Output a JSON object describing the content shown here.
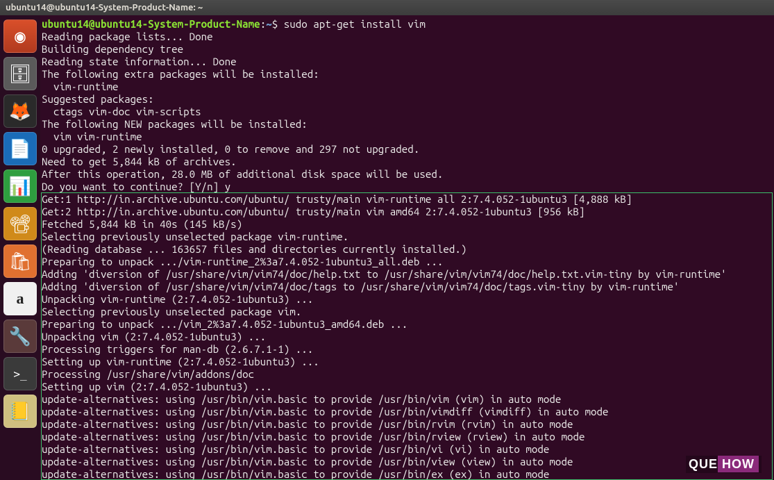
{
  "window": {
    "title": "ubuntu14@ubuntu14-System-Product-Name: ~"
  },
  "launcher": {
    "items": [
      {
        "name": "dash-icon",
        "glyph": "◉"
      },
      {
        "name": "files-icon",
        "glyph": "🗄"
      },
      {
        "name": "firefox-icon",
        "glyph": "🦊"
      },
      {
        "name": "writer-icon",
        "glyph": "📄"
      },
      {
        "name": "calc-icon",
        "glyph": "📊"
      },
      {
        "name": "impress-icon",
        "glyph": "📽"
      },
      {
        "name": "software-center-icon",
        "glyph": "🛍"
      },
      {
        "name": "amazon-icon",
        "glyph": "a"
      },
      {
        "name": "settings-icon",
        "glyph": "🔧"
      },
      {
        "name": "terminal-icon",
        "glyph": ">_"
      },
      {
        "name": "help-icon",
        "glyph": "📒"
      }
    ]
  },
  "prompt": {
    "userhost": "ubuntu14@ubuntu14-System-Product-Name",
    "path": "~",
    "command": "sudo apt-get install vim"
  },
  "output_top": [
    "Reading package lists... Done",
    "Building dependency tree",
    "Reading state information... Done",
    "The following extra packages will be installed:",
    "  vim-runtime",
    "Suggested packages:",
    "  ctags vim-doc vim-scripts",
    "The following NEW packages will be installed:",
    "  vim vim-runtime",
    "0 upgraded, 2 newly installed, 0 to remove and 297 not upgraded.",
    "Need to get 5,844 kB of archives.",
    "After this operation, 28.0 MB of additional disk space will be used.",
    "Do you want to continue? [Y/n] y"
  ],
  "output_box": [
    "Get:1 http://in.archive.ubuntu.com/ubuntu/ trusty/main vim-runtime all 2:7.4.052-1ubuntu3 [4,888 kB]",
    "Get:2 http://in.archive.ubuntu.com/ubuntu/ trusty/main vim amd64 2:7.4.052-1ubuntu3 [956 kB]",
    "Fetched 5,844 kB in 40s (145 kB/s)",
    "Selecting previously unselected package vim-runtime.",
    "(Reading database ... 163657 files and directories currently installed.)",
    "Preparing to unpack .../vim-runtime_2%3a7.4.052-1ubuntu3_all.deb ...",
    "Adding 'diversion of /usr/share/vim/vim74/doc/help.txt to /usr/share/vim/vim74/doc/help.txt.vim-tiny by vim-runtime'",
    "Adding 'diversion of /usr/share/vim/vim74/doc/tags to /usr/share/vim/vim74/doc/tags.vim-tiny by vim-runtime'",
    "Unpacking vim-runtime (2:7.4.052-1ubuntu3) ...",
    "Selecting previously unselected package vim.",
    "Preparing to unpack .../vim_2%3a7.4.052-1ubuntu3_amd64.deb ...",
    "Unpacking vim (2:7.4.052-1ubuntu3) ...",
    "Processing triggers for man-db (2.6.7.1-1) ...",
    "Setting up vim-runtime (2:7.4.052-1ubuntu3) ...",
    "Processing /usr/share/vim/addons/doc",
    "Setting up vim (2:7.4.052-1ubuntu3) ...",
    "update-alternatives: using /usr/bin/vim.basic to provide /usr/bin/vim (vim) in auto mode",
    "update-alternatives: using /usr/bin/vim.basic to provide /usr/bin/vimdiff (vimdiff) in auto mode",
    "update-alternatives: using /usr/bin/vim.basic to provide /usr/bin/rvim (rvim) in auto mode",
    "update-alternatives: using /usr/bin/vim.basic to provide /usr/bin/rview (rview) in auto mode",
    "update-alternatives: using /usr/bin/vim.basic to provide /usr/bin/vi (vi) in auto mode",
    "update-alternatives: using /usr/bin/vim.basic to provide /usr/bin/view (view) in auto mode",
    "update-alternatives: using /usr/bin/vim.basic to provide /usr/bin/ex (ex) in auto mode"
  ],
  "watermark": {
    "que": "QUE",
    "how": "HOW"
  }
}
